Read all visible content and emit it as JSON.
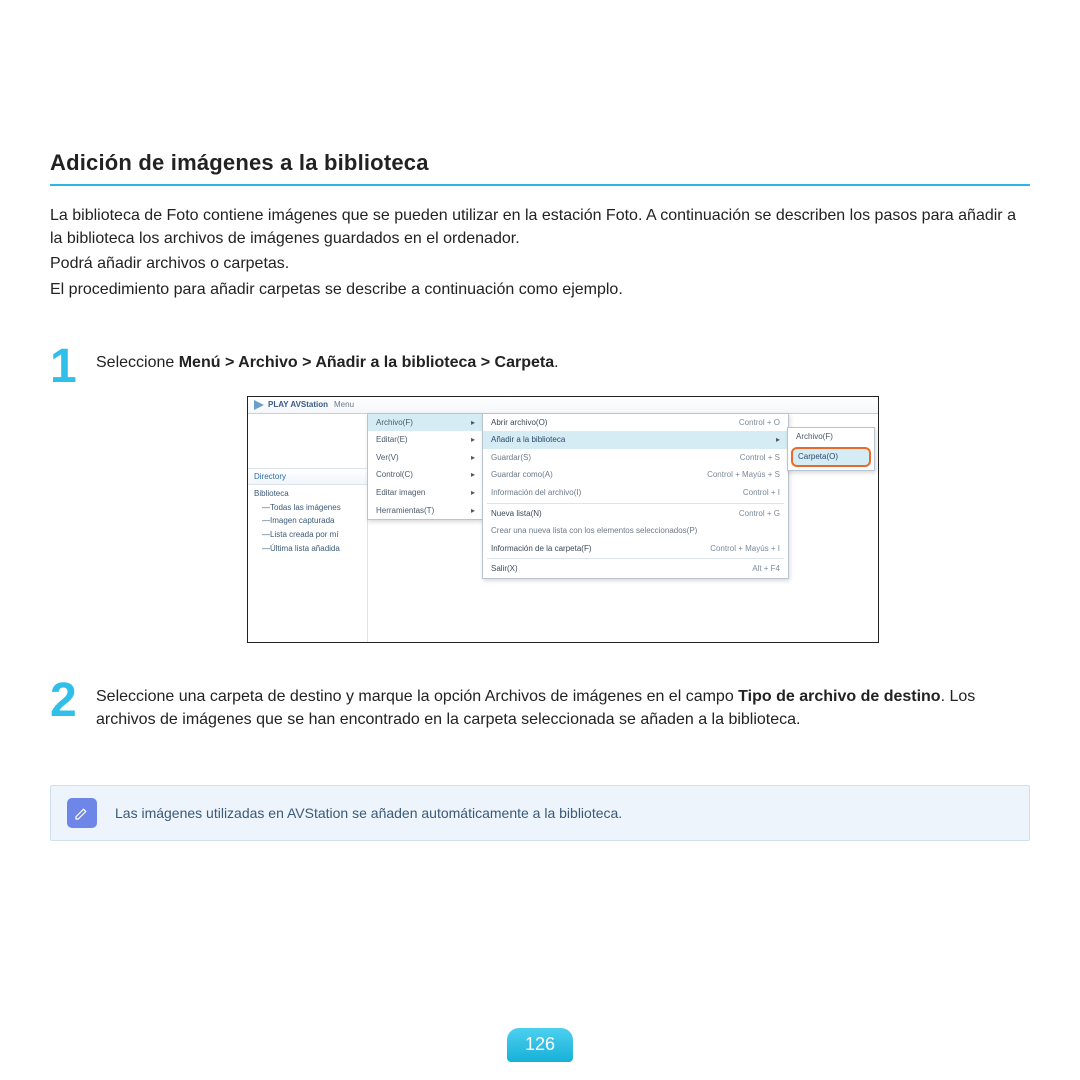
{
  "title": "Adición de imágenes a la biblioteca",
  "intro": {
    "p1": "La biblioteca de Foto contiene imágenes que se pueden utilizar en la estación Foto. A continuación se describen los pasos para añadir a la biblioteca los archivos de imágenes guardados en el ordenador.",
    "p2": "Podrá añadir archivos o carpetas.",
    "p3": "El procedimiento para añadir carpetas se describe a continuación como ejemplo."
  },
  "steps": {
    "one_num": "1",
    "one_lead": "Seleccione ",
    "one_bold": "Menú > Archivo > Añadir a la biblioteca > Carpeta",
    "one_tail": ".",
    "two_num": "2",
    "two_a": "Seleccione una carpeta de destino y marque la opción Archivos de imágenes en el campo ",
    "two_b_bold": "Tipo de archivo de destino",
    "two_c": ". Los archivos de imágenes que se han encontrado en la carpeta seleccionada se añaden a la biblioteca."
  },
  "note": "Las imágenes utilizadas en AVStation se añaden automáticamente a la biblioteca.",
  "page_number": "126",
  "shot": {
    "app_title": "PLAY AVStation",
    "menu_label": "Menu",
    "dir_header": "Directory",
    "lib_root": "Biblioteca",
    "lib_items": [
      "—Todas las imágenes",
      "—Imagen capturada",
      "—Lista creada por mí",
      "—Última lista añadida"
    ],
    "menu1": [
      {
        "label": "Archivo(F)",
        "sel": true
      },
      {
        "label": "Editar(E)"
      },
      {
        "label": "Ver(V)"
      },
      {
        "label": "Control(C)"
      },
      {
        "label": "Editar imagen"
      },
      {
        "label": "Herramientas(T)"
      }
    ],
    "menu2": [
      {
        "label": "Abrir archivo(O)",
        "sc": "Control + O",
        "dark": true
      },
      {
        "label": "Añadir a la biblioteca",
        "sc": "",
        "sel": true,
        "dark": true,
        "arrow": true
      },
      {
        "label": "Guardar(S)",
        "sc": "Control + S"
      },
      {
        "label": "Guardar como(A)",
        "sc": "Control + Mayús + S"
      },
      {
        "label": "Información del archivo(I)",
        "sc": "Control + I"
      },
      {
        "sep": true
      },
      {
        "label": "Nueva lista(N)",
        "sc": "Control + G",
        "dark": true
      },
      {
        "label": "Crear una nueva lista con los elementos seleccionados(P)",
        "sc": ""
      },
      {
        "label": "Información de la carpeta(F)",
        "sc": "Control + Mayús + I",
        "dark": true
      },
      {
        "sep": true
      },
      {
        "label": "Salir(X)",
        "sc": "Alt + F4",
        "dark": true
      }
    ],
    "menu3": [
      {
        "label": "Archivo(F)"
      },
      {
        "label": "Carpeta(O)",
        "hl": true
      }
    ]
  }
}
